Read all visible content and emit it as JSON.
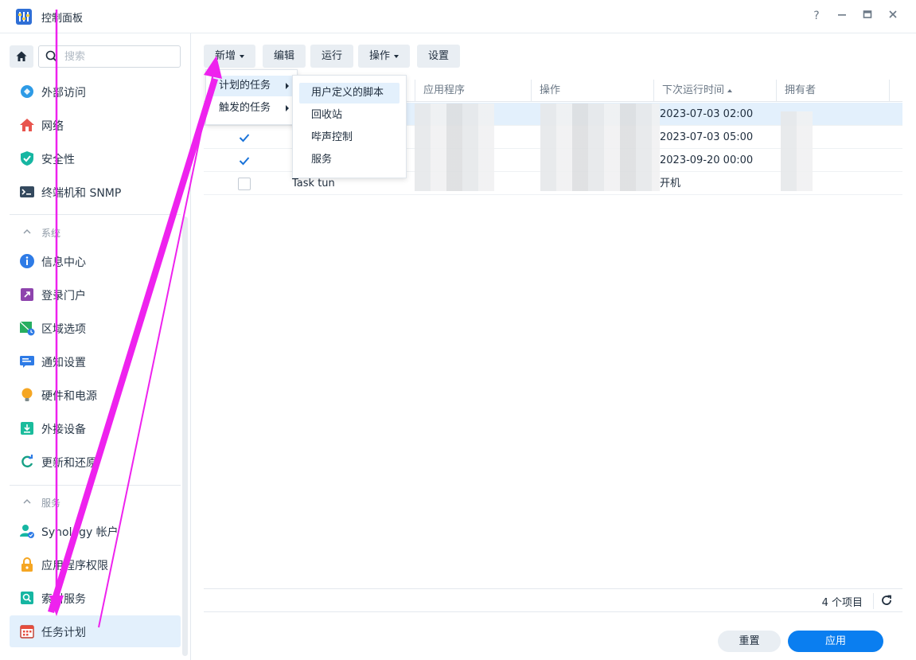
{
  "window": {
    "title": "控制面板",
    "help_label": "?"
  },
  "sidebar": {
    "search_placeholder": "搜索",
    "items_top": [
      {
        "label": "外部访问",
        "icon": "external-access-icon"
      },
      {
        "label": "网络",
        "icon": "network-icon"
      },
      {
        "label": "安全性",
        "icon": "security-shield-icon"
      },
      {
        "label": "终端机和 SNMP",
        "icon": "terminal-icon"
      }
    ],
    "section_system": "系统",
    "items_system": [
      {
        "label": "信息中心",
        "icon": "info-center-icon"
      },
      {
        "label": "登录门户",
        "icon": "login-portal-icon"
      },
      {
        "label": "区域选项",
        "icon": "regional-options-icon"
      },
      {
        "label": "通知设置",
        "icon": "notification-icon"
      },
      {
        "label": "硬件和电源",
        "icon": "hardware-power-icon"
      },
      {
        "label": "外接设备",
        "icon": "external-devices-icon"
      },
      {
        "label": "更新和还原",
        "icon": "update-restore-icon"
      }
    ],
    "section_services": "服务",
    "items_services": [
      {
        "label": "Synology 帐户",
        "icon": "synology-account-icon"
      },
      {
        "label": "应用程序权限",
        "icon": "app-privileges-icon"
      },
      {
        "label": "索引服务",
        "icon": "indexing-service-icon"
      },
      {
        "label": "任务计划",
        "icon": "task-scheduler-icon",
        "active": true
      }
    ]
  },
  "toolbar": {
    "create": "新增",
    "edit": "编辑",
    "run": "运行",
    "action": "操作",
    "settings": "设置"
  },
  "menu_create": {
    "scheduled_task": "计划的任务",
    "triggered_task": "触发的任务"
  },
  "submenu_scheduled": {
    "user_script": "用户定义的脚本",
    "recycle_bin": "回收站",
    "beep_control": "哔声控制",
    "service": "服务"
  },
  "grid": {
    "columns": {
      "app": "应用程序",
      "action": "操作",
      "next_run": "下次运行时间",
      "owner": "拥有者"
    },
    "rows": [
      {
        "checked": true,
        "task": "",
        "next_run": "2023-07-03 02:00",
        "selected": true
      },
      {
        "checked": true,
        "task": "",
        "next_run": "2023-07-03 05:00",
        "selected": false
      },
      {
        "checked": true,
        "task": "",
        "next_run": "2023-09-20 00:00",
        "selected": false
      },
      {
        "checked": false,
        "task": "Task tun",
        "next_run": "开机",
        "selected": false
      }
    ],
    "item_count": "4 个项目"
  },
  "footer": {
    "reset": "重置",
    "apply": "应用"
  },
  "colors": {
    "accent": "#0a7ef0",
    "selection": "#e3f0fc",
    "annotation": "#ee22ee"
  }
}
